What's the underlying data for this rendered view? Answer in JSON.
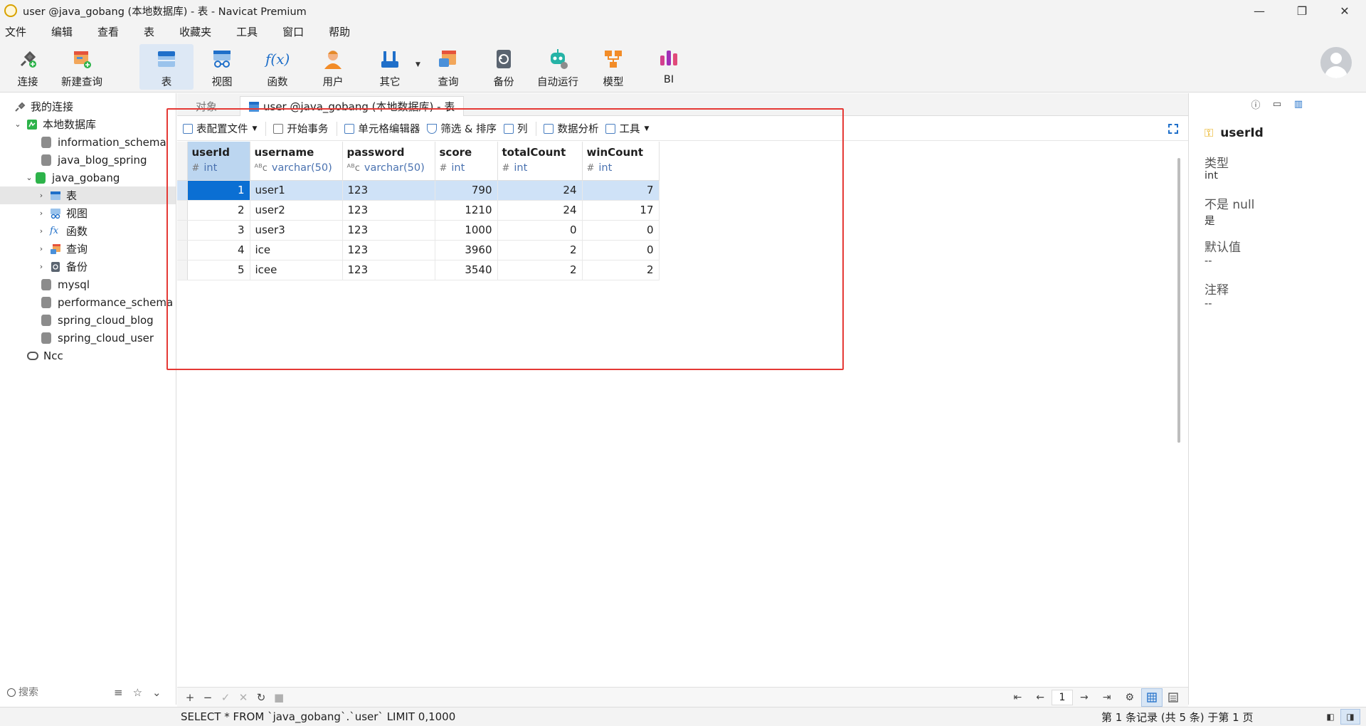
{
  "window": {
    "title": "user @java_gobang (本地数据库) - 表 - Navicat Premium",
    "controls": {
      "minimize": "—",
      "restore": "❐",
      "close": "✕"
    }
  },
  "menu": [
    "文件",
    "编辑",
    "查看",
    "表",
    "收藏夹",
    "工具",
    "窗口",
    "帮助"
  ],
  "toolbar": {
    "connect": "连接",
    "new_query": "新建查询",
    "table": "表",
    "view": "视图",
    "function": "函数",
    "function_icon_text": "f(x)",
    "user": "用户",
    "other": "其它",
    "query": "查询",
    "backup": "备份",
    "automation": "自动运行",
    "model": "模型",
    "bi": "BI"
  },
  "navigator": {
    "my_connections": "我的连接",
    "connection_name": "本地数据库",
    "databases": [
      "information_schema",
      "java_blog_spring",
      "java_gobang"
    ],
    "open_db_children": [
      "表",
      "视图",
      "函数",
      "查询",
      "备份"
    ],
    "more_databases": [
      "mysql",
      "performance_schema",
      "spring_cloud_blog",
      "spring_cloud_user"
    ],
    "other_connection": "Ncc",
    "search_placeholder": "搜索"
  },
  "tabs": {
    "objects": "对象",
    "active": "user @java_gobang (本地数据库) - 表"
  },
  "table_tools": {
    "config_file": "表配置文件",
    "begin_transaction": "开始事务",
    "cell_editor": "单元格编辑器",
    "filter_sort": "筛选 & 排序",
    "columns": "列",
    "data_analysis": "数据分析",
    "tools": "工具"
  },
  "grid": {
    "columns": [
      {
        "name": "userId",
        "type": "int",
        "sym": "#"
      },
      {
        "name": "username",
        "type": "varchar(50)",
        "sym": "ᴬᴮc"
      },
      {
        "name": "password",
        "type": "varchar(50)",
        "sym": "ᴬᴮc"
      },
      {
        "name": "score",
        "type": "int",
        "sym": "#"
      },
      {
        "name": "totalCount",
        "type": "int",
        "sym": "#"
      },
      {
        "name": "winCount",
        "type": "int",
        "sym": "#"
      }
    ],
    "rows": [
      [
        "1",
        "user1",
        "123",
        "790",
        "24",
        "7"
      ],
      [
        "2",
        "user2",
        "123",
        "1210",
        "24",
        "17"
      ],
      [
        "3",
        "user3",
        "123",
        "1000",
        "0",
        "0"
      ],
      [
        "4",
        "ice",
        "123",
        "3960",
        "2",
        "0"
      ],
      [
        "5",
        "icee",
        "123",
        "3540",
        "2",
        "2"
      ]
    ]
  },
  "footer": {
    "add": "+",
    "remove": "−",
    "apply": "✓",
    "discard": "✕",
    "refresh": "↻",
    "stop": "■",
    "first": "⇤",
    "prev": "←",
    "page": "1",
    "next": "→",
    "last": "⇥",
    "settings": "⚙"
  },
  "info_panel": {
    "field_name": "userId",
    "type_label": "类型",
    "type_value": "int",
    "notnull_label": "不是 null",
    "notnull_value": "是",
    "default_label": "默认值",
    "default_value": "--",
    "comment_label": "注释",
    "comment_value": "--"
  },
  "status": {
    "sql": "SELECT * FROM `java_gobang`.`user` LIMIT 0,1000",
    "records": "第 1 条记录 (共 5 条) 于第 1 页"
  },
  "colors": {
    "accent": "#0b6fd3",
    "highlight_box": "#e53935",
    "selected_row": "#cfe2f7"
  }
}
